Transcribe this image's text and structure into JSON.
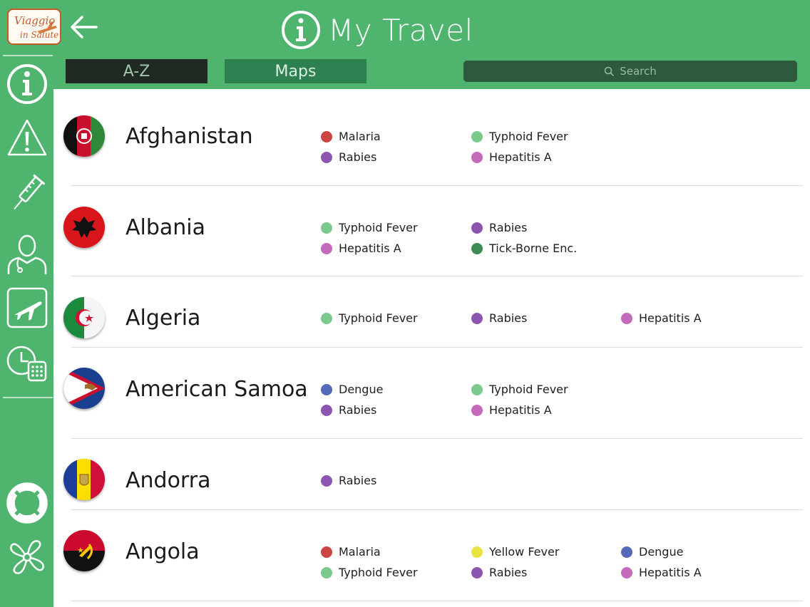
{
  "app": {
    "title": "My Travel",
    "logo_text_line1": "Viaggio",
    "logo_text_line2": "in Salute"
  },
  "tabs": [
    {
      "label": "A-Z",
      "selected": true
    },
    {
      "label": "Maps",
      "selected": false
    }
  ],
  "search": {
    "placeholder": "Search"
  },
  "colors": {
    "primary_green": "#4fb46e",
    "Malaria": "#cc4444",
    "Typhoid Fever": "#7cc98d",
    "Rabies": "#8c56b0",
    "Hepatitis A": "#c46aba",
    "Tick-Borne Enc.": "#3e8a55",
    "Dengue": "#5568ba",
    "Yellow Fever": "#ebe244"
  },
  "sidebar": {
    "items": [
      {
        "name": "info-icon"
      },
      {
        "name": "warning-icon"
      },
      {
        "name": "syringe-icon"
      },
      {
        "name": "doctor-icon"
      },
      {
        "name": "airplane-icon"
      },
      {
        "name": "clock-calendar-icon"
      },
      {
        "name": "lifebuoy-icon"
      },
      {
        "name": "propeller-icon"
      }
    ]
  },
  "countries": [
    {
      "name": "Afghanistan",
      "flag": "afghanistan",
      "diseases": [
        "Malaria",
        "Typhoid Fever",
        "Rabies",
        "Hepatitis A"
      ]
    },
    {
      "name": "Albania",
      "flag": "albania",
      "diseases": [
        "Typhoid Fever",
        "Rabies",
        "Hepatitis A",
        "Tick-Borne Enc."
      ]
    },
    {
      "name": "Algeria",
      "flag": "algeria",
      "diseases": [
        "Typhoid Fever",
        "Rabies",
        "Hepatitis A"
      ]
    },
    {
      "name": "American Samoa",
      "flag": "american-samoa",
      "diseases": [
        "Dengue",
        "Typhoid Fever",
        "Rabies",
        "Hepatitis A"
      ]
    },
    {
      "name": "Andorra",
      "flag": "andorra",
      "diseases": [
        "Rabies"
      ]
    },
    {
      "name": "Angola",
      "flag": "angola",
      "diseases": [
        "Malaria",
        "Yellow Fever",
        "Dengue",
        "Typhoid Fever",
        "Rabies",
        "Hepatitis A"
      ]
    }
  ]
}
